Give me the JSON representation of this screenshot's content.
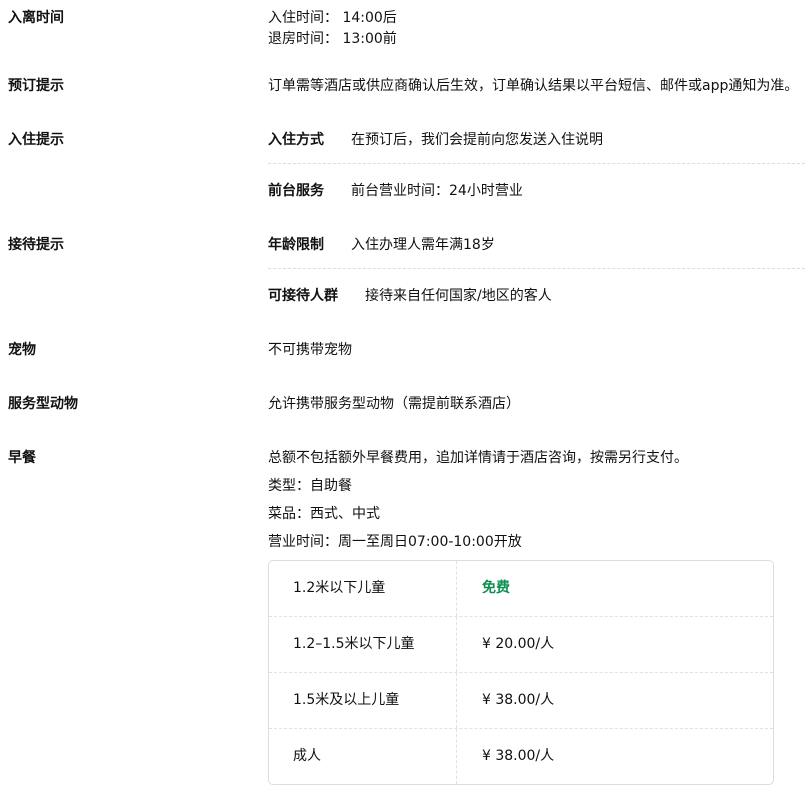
{
  "colors": {
    "green": "#0e8f50"
  },
  "sections": [
    {
      "label": "入离时间",
      "lines": [
        "入住时间： 14:00后",
        "退房时间： 13:00前"
      ]
    },
    {
      "label": "预订提示",
      "lines": [
        "订单需等酒店或供应商确认后生效，订单确认结果以平台短信、邮件或app通知为准。"
      ]
    },
    {
      "label": "入住提示",
      "subrows": [
        {
          "title": "入住方式",
          "text": "在预订后，我们会提前向您发送入住说明"
        },
        {
          "title": "前台服务",
          "text": "前台营业时间：24小时营业"
        }
      ]
    },
    {
      "label": "接待提示",
      "subrows": [
        {
          "title": "年龄限制",
          "text": "入住办理人需年满18岁"
        },
        {
          "title": "可接待人群",
          "text": "接待来自任何国家/地区的客人"
        }
      ]
    },
    {
      "label": "宠物",
      "lines": [
        "不可携带宠物"
      ]
    },
    {
      "label": "服务型动物",
      "lines": [
        "允许携带服务型动物（需提前联系酒店）"
      ]
    },
    {
      "label": "早餐",
      "lines": [
        "总额不包括额外早餐费用，追加详情请于酒店咨询，按需另行支付。",
        "类型：自助餐",
        "菜品：西式、中式",
        "营业时间：周一至周日07:00-10:00开放"
      ]
    }
  ],
  "breakfast_table": {
    "rows": [
      {
        "category": "1.2米以下儿童",
        "price": "免费"
      },
      {
        "category": "1.2–1.5米以下儿童",
        "price": "¥ 20.00/人"
      },
      {
        "category": "1.5米及以上儿童",
        "price": "¥ 38.00/人"
      },
      {
        "category": "成人",
        "price": "¥ 38.00/人"
      }
    ]
  }
}
